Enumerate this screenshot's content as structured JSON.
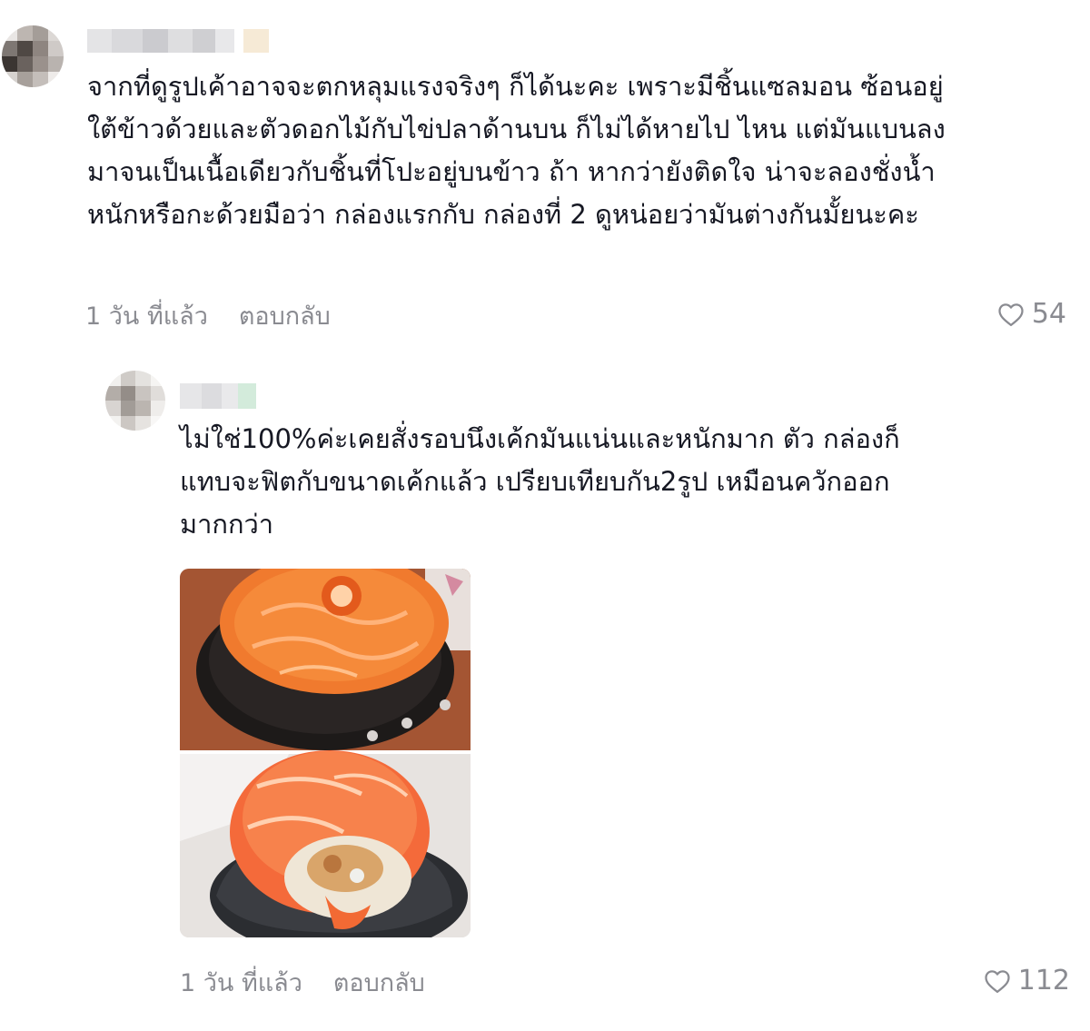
{
  "comments": [
    {
      "text": "จากที่ดูรูปเค้าอาจจะตกหลุมแรงจริงๆ ก็ได้นะคะ เพราะมีชิ้นแซลมอน ซ้อนอยู่ใต้ข้าวด้วยและตัวดอกไม้กับไข่ปลาด้านบน ก็ไม่ได้หายไป ไหน แต่มันแบนลงมาจนเป็นเนื้อเดียวกับชิ้นที่โปะอยู่บนข้าว ถ้า หากว่ายังติดใจ น่าจะลองชั่งน้ำหนักหรือกะด้วยมือว่า กล่องแรกกับ กล่องที่ 2 ดูหน่อยว่ามันต่างกันมั้ยนะคะ",
      "time": "1 วัน ที่แล้ว",
      "reply_label": "ตอบกลับ",
      "likes": "54"
    },
    {
      "text": "ไม่ใช่100%ค่ะเคยสั่งรอบนึงเค้กมันแน่นและหนักมาก ตัว กล่องก็แทบจะฟิตกับขนาดเค้กแล้ว เปรียบเทียบกัน2รูป เหมือนควักออกมากกว่า",
      "time": "1 วัน ที่แล้ว",
      "reply_label": "ตอบกลับ",
      "likes": "112"
    }
  ],
  "icons": {
    "like": "heart-outline-icon"
  },
  "colors": {
    "text": "#161823",
    "muted": "#8a8b91",
    "salmon": "#f07a3c"
  }
}
